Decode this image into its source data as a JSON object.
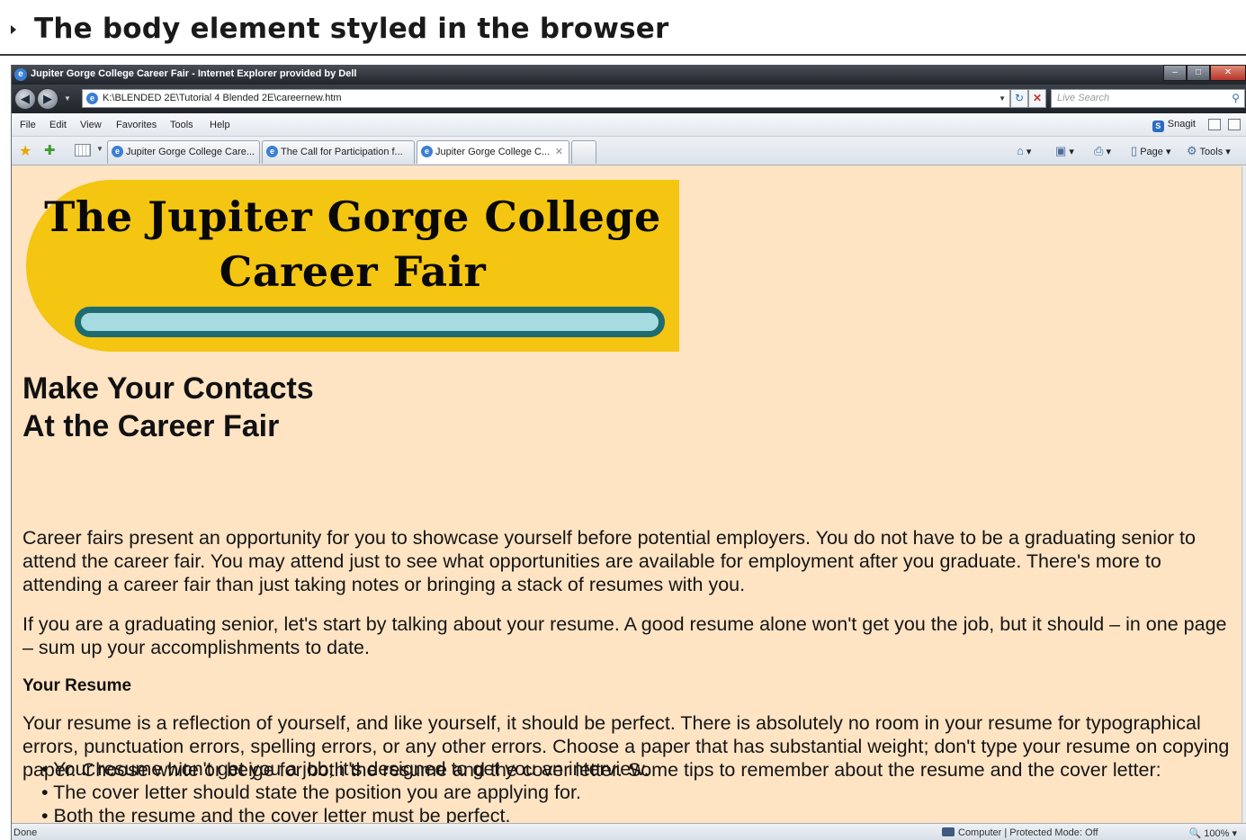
{
  "slide": {
    "caption": "The body element styled in the browser"
  },
  "browser": {
    "title": "Jupiter Gorge College Career Fair - Internet Explorer provided by Dell",
    "address": "K:\\BLENDED 2E\\Tutorial 4 Blended 2E\\careernew.htm",
    "search_placeholder": "Live Search",
    "menu": [
      "File",
      "Edit",
      "View",
      "Favorites",
      "Tools",
      "Help"
    ],
    "snagit": "Snagit",
    "tabs": [
      {
        "label": "Jupiter Gorge College Care..."
      },
      {
        "label": "The Call for Participation f..."
      },
      {
        "label": "Jupiter Gorge College C..."
      }
    ],
    "commands": {
      "page": "Page",
      "tools": "Tools"
    },
    "status": {
      "left": "Done",
      "zone": "Computer | Protected Mode: Off",
      "zoom": "100%"
    }
  },
  "page": {
    "banner": {
      "line1": "The Jupiter Gorge College",
      "line2": "Career Fair"
    },
    "heading": {
      "line1": "Make Your Contacts",
      "line2": "At the Career Fair"
    },
    "para1": "Career fairs present an opportunity for you to showcase yourself before potential employers. You do not have to be a graduating senior to attend the career fair. You may attend just to see what opportunities are available for employment after you graduate. There's more to attending a career fair than just taking notes or bringing a stack of resumes with you.",
    "para2": "If you are a graduating senior, let's start by talking about your resume. A good resume alone won't get you the job, but it should – in one page – sum up your accomplishments to date.",
    "subheading": "Your Resume",
    "para3": "Your resume is a reflection of yourself, and like yourself, it should be perfect. There is absolutely no room in your resume for typographical errors, punctuation errors, spelling errors, or any other errors. Choose a paper that has substantial weight; don't type your resume on copying paper. Choose white or beige for both the resume and the cover letter. Some tips to remember about the resume and the cover letter:",
    "tips": [
      "Your resume won't get you a job; it's designed to get you an interview.",
      "The cover letter should state the position you are applying for.",
      "Both the resume and the cover letter must be perfect."
    ]
  },
  "colors": {
    "page_background": "#ffe4c4",
    "banner_yellow": "#f4c511",
    "banner_bar": "#a6dbe2",
    "banner_bar_border": "#1f6c70"
  }
}
